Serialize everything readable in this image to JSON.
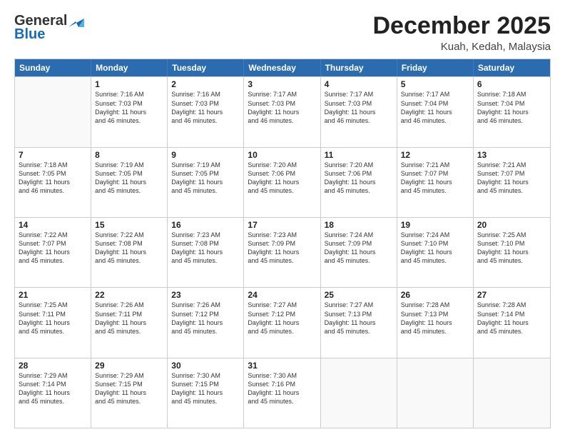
{
  "logo": {
    "line1": "General",
    "line2": "Blue",
    "icon": "▶"
  },
  "title": "December 2025",
  "subtitle": "Kuah, Kedah, Malaysia",
  "header_days": [
    "Sunday",
    "Monday",
    "Tuesday",
    "Wednesday",
    "Thursday",
    "Friday",
    "Saturday"
  ],
  "weeks": [
    [
      {
        "day": "",
        "empty": true,
        "info": ""
      },
      {
        "day": "1",
        "empty": false,
        "info": "Sunrise: 7:16 AM\nSunset: 7:03 PM\nDaylight: 11 hours\nand 46 minutes."
      },
      {
        "day": "2",
        "empty": false,
        "info": "Sunrise: 7:16 AM\nSunset: 7:03 PM\nDaylight: 11 hours\nand 46 minutes."
      },
      {
        "day": "3",
        "empty": false,
        "info": "Sunrise: 7:17 AM\nSunset: 7:03 PM\nDaylight: 11 hours\nand 46 minutes."
      },
      {
        "day": "4",
        "empty": false,
        "info": "Sunrise: 7:17 AM\nSunset: 7:03 PM\nDaylight: 11 hours\nand 46 minutes."
      },
      {
        "day": "5",
        "empty": false,
        "info": "Sunrise: 7:17 AM\nSunset: 7:04 PM\nDaylight: 11 hours\nand 46 minutes."
      },
      {
        "day": "6",
        "empty": false,
        "info": "Sunrise: 7:18 AM\nSunset: 7:04 PM\nDaylight: 11 hours\nand 46 minutes."
      }
    ],
    [
      {
        "day": "7",
        "empty": false,
        "info": "Sunrise: 7:18 AM\nSunset: 7:05 PM\nDaylight: 11 hours\nand 46 minutes."
      },
      {
        "day": "8",
        "empty": false,
        "info": "Sunrise: 7:19 AM\nSunset: 7:05 PM\nDaylight: 11 hours\nand 45 minutes."
      },
      {
        "day": "9",
        "empty": false,
        "info": "Sunrise: 7:19 AM\nSunset: 7:05 PM\nDaylight: 11 hours\nand 45 minutes."
      },
      {
        "day": "10",
        "empty": false,
        "info": "Sunrise: 7:20 AM\nSunset: 7:06 PM\nDaylight: 11 hours\nand 45 minutes."
      },
      {
        "day": "11",
        "empty": false,
        "info": "Sunrise: 7:20 AM\nSunset: 7:06 PM\nDaylight: 11 hours\nand 45 minutes."
      },
      {
        "day": "12",
        "empty": false,
        "info": "Sunrise: 7:21 AM\nSunset: 7:07 PM\nDaylight: 11 hours\nand 45 minutes."
      },
      {
        "day": "13",
        "empty": false,
        "info": "Sunrise: 7:21 AM\nSunset: 7:07 PM\nDaylight: 11 hours\nand 45 minutes."
      }
    ],
    [
      {
        "day": "14",
        "empty": false,
        "info": "Sunrise: 7:22 AM\nSunset: 7:07 PM\nDaylight: 11 hours\nand 45 minutes."
      },
      {
        "day": "15",
        "empty": false,
        "info": "Sunrise: 7:22 AM\nSunset: 7:08 PM\nDaylight: 11 hours\nand 45 minutes."
      },
      {
        "day": "16",
        "empty": false,
        "info": "Sunrise: 7:23 AM\nSunset: 7:08 PM\nDaylight: 11 hours\nand 45 minutes."
      },
      {
        "day": "17",
        "empty": false,
        "info": "Sunrise: 7:23 AM\nSunset: 7:09 PM\nDaylight: 11 hours\nand 45 minutes."
      },
      {
        "day": "18",
        "empty": false,
        "info": "Sunrise: 7:24 AM\nSunset: 7:09 PM\nDaylight: 11 hours\nand 45 minutes."
      },
      {
        "day": "19",
        "empty": false,
        "info": "Sunrise: 7:24 AM\nSunset: 7:10 PM\nDaylight: 11 hours\nand 45 minutes."
      },
      {
        "day": "20",
        "empty": false,
        "info": "Sunrise: 7:25 AM\nSunset: 7:10 PM\nDaylight: 11 hours\nand 45 minutes."
      }
    ],
    [
      {
        "day": "21",
        "empty": false,
        "info": "Sunrise: 7:25 AM\nSunset: 7:11 PM\nDaylight: 11 hours\nand 45 minutes."
      },
      {
        "day": "22",
        "empty": false,
        "info": "Sunrise: 7:26 AM\nSunset: 7:11 PM\nDaylight: 11 hours\nand 45 minutes."
      },
      {
        "day": "23",
        "empty": false,
        "info": "Sunrise: 7:26 AM\nSunset: 7:12 PM\nDaylight: 11 hours\nand 45 minutes."
      },
      {
        "day": "24",
        "empty": false,
        "info": "Sunrise: 7:27 AM\nSunset: 7:12 PM\nDaylight: 11 hours\nand 45 minutes."
      },
      {
        "day": "25",
        "empty": false,
        "info": "Sunrise: 7:27 AM\nSunset: 7:13 PM\nDaylight: 11 hours\nand 45 minutes."
      },
      {
        "day": "26",
        "empty": false,
        "info": "Sunrise: 7:28 AM\nSunset: 7:13 PM\nDaylight: 11 hours\nand 45 minutes."
      },
      {
        "day": "27",
        "empty": false,
        "info": "Sunrise: 7:28 AM\nSunset: 7:14 PM\nDaylight: 11 hours\nand 45 minutes."
      }
    ],
    [
      {
        "day": "28",
        "empty": false,
        "info": "Sunrise: 7:29 AM\nSunset: 7:14 PM\nDaylight: 11 hours\nand 45 minutes."
      },
      {
        "day": "29",
        "empty": false,
        "info": "Sunrise: 7:29 AM\nSunset: 7:15 PM\nDaylight: 11 hours\nand 45 minutes."
      },
      {
        "day": "30",
        "empty": false,
        "info": "Sunrise: 7:30 AM\nSunset: 7:15 PM\nDaylight: 11 hours\nand 45 minutes."
      },
      {
        "day": "31",
        "empty": false,
        "info": "Sunrise: 7:30 AM\nSunset: 7:16 PM\nDaylight: 11 hours\nand 45 minutes."
      },
      {
        "day": "",
        "empty": true,
        "info": ""
      },
      {
        "day": "",
        "empty": true,
        "info": ""
      },
      {
        "day": "",
        "empty": true,
        "info": ""
      }
    ]
  ]
}
